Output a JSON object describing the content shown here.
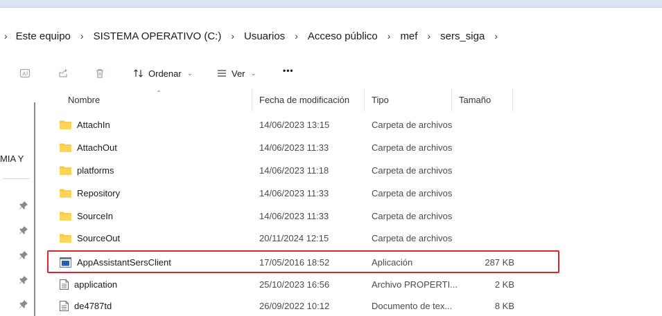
{
  "breadcrumb": {
    "items": [
      "Este equipo",
      "SISTEMA OPERATIVO (C:)",
      "Usuarios",
      "Acceso público",
      "mef",
      "sers_siga"
    ]
  },
  "toolbar": {
    "sort_label": "Ordenar",
    "view_label": "Ver",
    "more_label": "•••"
  },
  "sidebar": {
    "partial_text": "MIA Y"
  },
  "columns": {
    "name": "Nombre",
    "date": "Fecha de modificación",
    "type": "Tipo",
    "size": "Tamaño"
  },
  "files": [
    {
      "name": "AttachIn",
      "date": "14/06/2023 13:15",
      "type": "Carpeta de archivos",
      "size": "",
      "icon": "folder-icon"
    },
    {
      "name": "AttachOut",
      "date": "14/06/2023 11:33",
      "type": "Carpeta de archivos",
      "size": "",
      "icon": "folder-icon"
    },
    {
      "name": "platforms",
      "date": "14/06/2023 11:18",
      "type": "Carpeta de archivos",
      "size": "",
      "icon": "folder-icon"
    },
    {
      "name": "Repository",
      "date": "14/06/2023 11:33",
      "type": "Carpeta de archivos",
      "size": "",
      "icon": "folder-icon"
    },
    {
      "name": "SourceIn",
      "date": "14/06/2023 11:33",
      "type": "Carpeta de archivos",
      "size": "",
      "icon": "folder-icon"
    },
    {
      "name": "SourceOut",
      "date": "20/11/2024 12:15",
      "type": "Carpeta de archivos",
      "size": "",
      "icon": "folder-icon"
    },
    {
      "name": "AppAssistantSersClient",
      "date": "17/05/2016 18:52",
      "type": "Aplicación",
      "size": "287 KB",
      "icon": "application-icon"
    },
    {
      "name": "application",
      "date": "25/10/2023 16:56",
      "type": "Archivo PROPERTI...",
      "size": "2 KB",
      "icon": "document-icon"
    },
    {
      "name": "de4787td",
      "date": "26/09/2022 10:12",
      "type": "Documento de tex...",
      "size": "8 KB",
      "icon": "text-document-icon"
    }
  ],
  "colors": {
    "folder": "#f6c843",
    "highlight": "#e0222a",
    "app_icon": "#1f5fbf"
  }
}
